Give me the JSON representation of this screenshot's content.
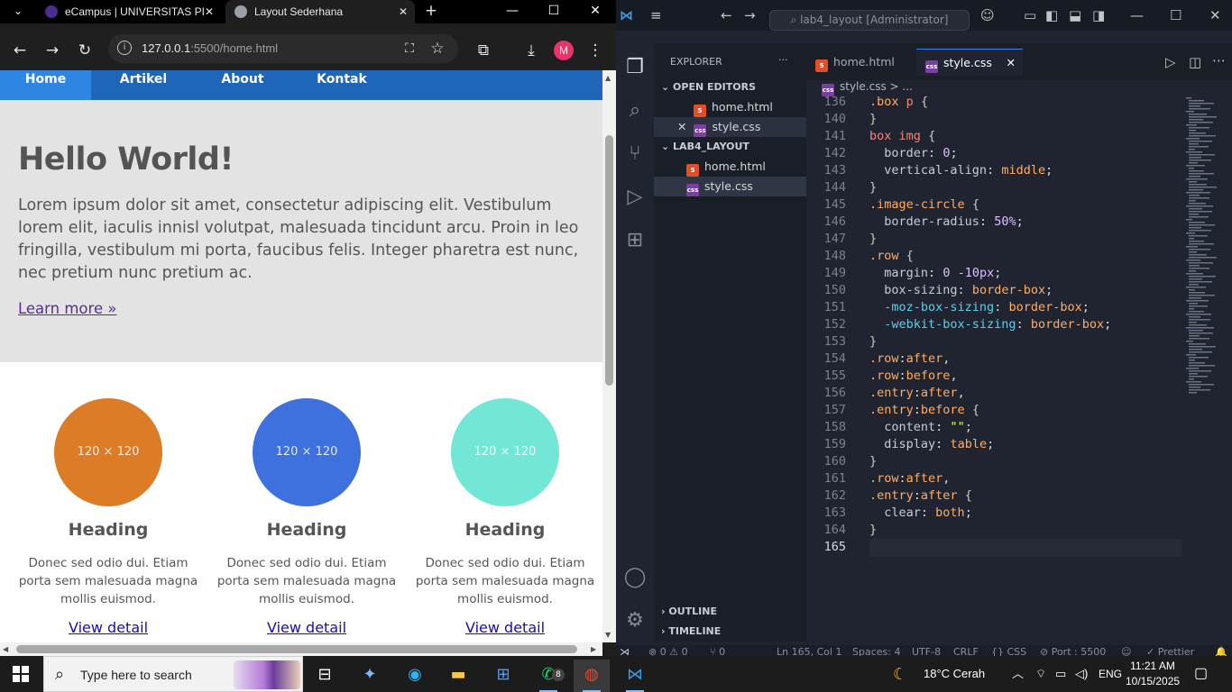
{
  "chrome": {
    "tabs": [
      {
        "title": "eCampus | UNIVERSITAS PI",
        "close": "✕"
      },
      {
        "title": "Layout Sederhana",
        "close": "✕"
      }
    ],
    "new_tab": "+",
    "url_host": "127.0.0.1",
    "url_path": ":5500/home.html",
    "profile_initial": "M",
    "win_min": "—",
    "win_max": "☐",
    "win_close": "✕"
  },
  "page": {
    "nav": [
      "Home",
      "Artikel",
      "About",
      "Kontak"
    ],
    "hero": {
      "title": "Hello World!",
      "text": "Lorem ipsum dolor sit amet, consectetur adipiscing elit. Vestibulum lorem elit, iaculis innisl volutpat, malesuada tincidunt arcu. Proin in leo fringilla, vestibulum mi porta, faucibus felis. Integer pharetra est nunc, nec pretium nunc pretium ac.",
      "link": "Learn more »"
    },
    "cards": [
      {
        "img": "120 × 120",
        "color": "#dc7c27",
        "heading": "Heading",
        "text": "Donec sed odio dui. Etiam porta sem malesuada magna mollis euismod.",
        "link": "View detail"
      },
      {
        "img": "120 × 120",
        "color": "#3e71de",
        "heading": "Heading",
        "text": "Donec sed odio dui. Etiam porta sem malesuada magna mollis euismod.",
        "link": "View detail"
      },
      {
        "img": "120 × 120",
        "color": "#72e7d6",
        "heading": "Heading",
        "text": "Donec sed odio dui. Etiam porta sem malesuada magna mollis euismod.",
        "link": "View detail"
      }
    ]
  },
  "vscode": {
    "command_center": "lab4_layout [Administrator]",
    "explorer_title": "EXPLORER",
    "explorer_more": "···",
    "open_editors": "OPEN EDITORS",
    "open_files": [
      "home.html",
      "style.css"
    ],
    "workspace": "LAB4_LAYOUT",
    "workspace_files": [
      "home.html",
      "style.css"
    ],
    "outline": "OUTLINE",
    "timeline": "TIMELINE",
    "tabs": [
      "home.html",
      "style.css"
    ],
    "breadcrumb": "style.css",
    "breadcrumb_more": "> ...",
    "line_numbers": [
      "136",
      "140",
      "141",
      "142",
      "143",
      "144",
      "145",
      "146",
      "147",
      "148",
      "149",
      "150",
      "151",
      "152",
      "153",
      "154",
      "155",
      "156",
      "157",
      "158",
      "159",
      "160",
      "161",
      "162",
      "163",
      "164",
      "165"
    ],
    "status": {
      "problems": "⊗ 0 ⚠ 0",
      "ports": "⑂ 0",
      "position": "Ln 165, Col 1",
      "spaces": "Spaces: 4",
      "encoding": "UTF-8",
      "eol": "CRLF",
      "language": "{} CSS",
      "port": "⊘ Port : 5500",
      "prettier": "✓ Prettier"
    }
  },
  "taskbar": {
    "search_placeholder": "Type here to search",
    "whatsapp_badge": "8",
    "weather": "18°C  Cerah",
    "language": "ENG",
    "time": "11:21 AM",
    "date": "10/15/2025"
  },
  "colors": {
    "nav_bg": "#1f65b8",
    "nav_active": "#2e85e2",
    "hero_bg": "#e3e3e3",
    "editor_bg": "#1f2430"
  }
}
